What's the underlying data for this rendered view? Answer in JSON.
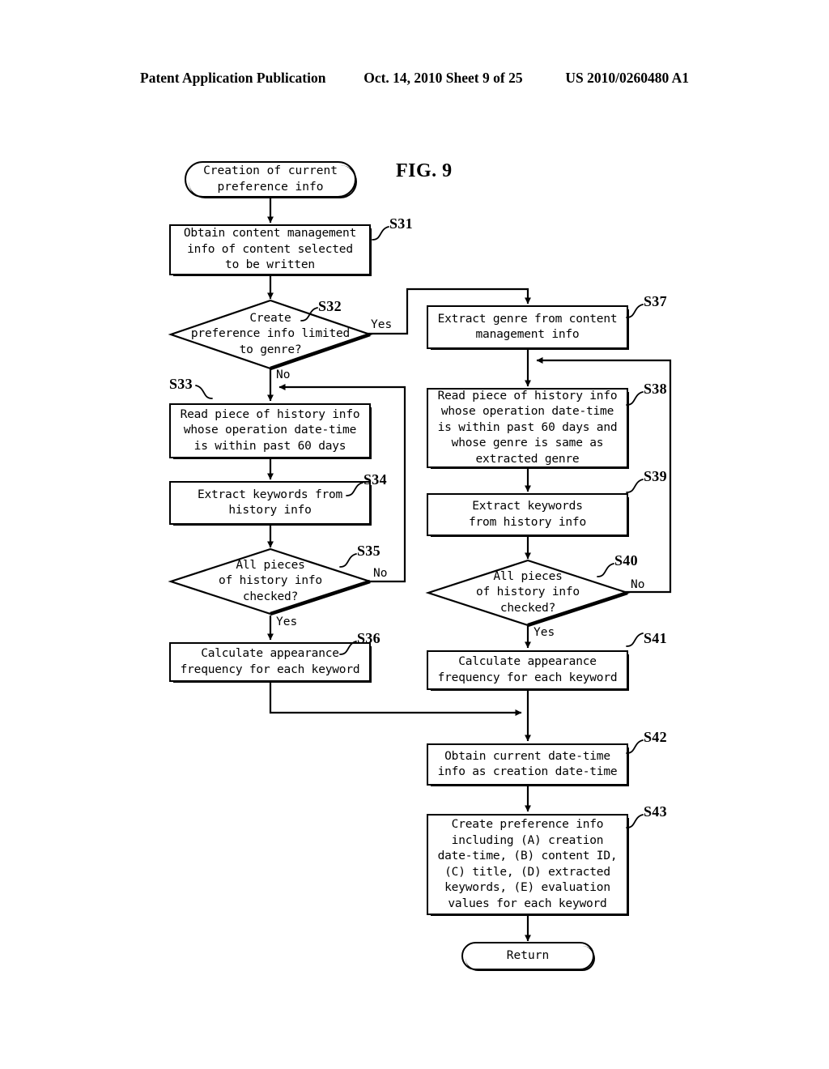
{
  "header": {
    "publication": "Patent Application Publication",
    "date_sheet": "Oct. 14, 2010  Sheet 9 of 25",
    "patent_number": "US 2010/0260480 A1"
  },
  "figure": {
    "label": "FIG. 9"
  },
  "flowchart": {
    "start": {
      "id": "start",
      "shape": "terminal",
      "text": "Creation of current\npreference info"
    },
    "end": {
      "id": "return",
      "shape": "terminal",
      "text": "Return"
    },
    "steps": [
      {
        "id": "S31",
        "ref": "S31",
        "shape": "process",
        "text": "Obtain content management\ninfo of content selected\nto be written"
      },
      {
        "id": "S32",
        "ref": "S32",
        "shape": "decision",
        "text": "Create\npreference info limited\nto genre?",
        "branches": [
          {
            "label": "Yes",
            "target": "S37"
          },
          {
            "label": "No",
            "target": "S33"
          }
        ]
      },
      {
        "id": "S33",
        "ref": "S33",
        "shape": "process",
        "text": "Read piece of history info\nwhose operation date-time\nis within past 60 days"
      },
      {
        "id": "S34",
        "ref": "S34",
        "shape": "process",
        "text": "Extract keywords from\nhistory info"
      },
      {
        "id": "S35",
        "ref": "S35",
        "shape": "decision",
        "text": "All pieces\nof history info\nchecked?",
        "branches": [
          {
            "label": "No",
            "target": "S33"
          },
          {
            "label": "Yes",
            "target": "S36"
          }
        ]
      },
      {
        "id": "S36",
        "ref": "S36",
        "shape": "process",
        "text": "Calculate appearance\nfrequency for each keyword"
      },
      {
        "id": "S37",
        "ref": "S37",
        "shape": "process",
        "text": "Extract genre from content\nmanagement info"
      },
      {
        "id": "S38",
        "ref": "S38",
        "shape": "process",
        "text": "Read piece of history info\nwhose operation date-time\nis within past 60 days and\nwhose genre is same as\nextracted genre"
      },
      {
        "id": "S39",
        "ref": "S39",
        "shape": "process",
        "text": "Extract keywords\nfrom history info"
      },
      {
        "id": "S40",
        "ref": "S40",
        "shape": "decision",
        "text": "All pieces\nof history info\nchecked?",
        "branches": [
          {
            "label": "No",
            "target": "S38"
          },
          {
            "label": "Yes",
            "target": "S41"
          }
        ]
      },
      {
        "id": "S41",
        "ref": "S41",
        "shape": "process",
        "text": "Calculate appearance\nfrequency for each keyword"
      },
      {
        "id": "S42",
        "ref": "S42",
        "shape": "process",
        "text": "Obtain current date-time\ninfo as creation date-time"
      },
      {
        "id": "S43",
        "ref": "S43",
        "shape": "process",
        "text": "Create preference info\nincluding (A) creation\ndate-time, (B) content ID,\n(C) title, (D) extracted\nkeywords, (E) evaluation\nvalues for each keyword"
      }
    ],
    "edge_labels": {
      "s32_yes": "Yes",
      "s32_no": "No",
      "s35_no": "No",
      "s35_yes": "Yes",
      "s40_no": "No",
      "s40_yes": "Yes"
    }
  },
  "colors": {
    "ink": "#000000",
    "paper": "#ffffff"
  }
}
